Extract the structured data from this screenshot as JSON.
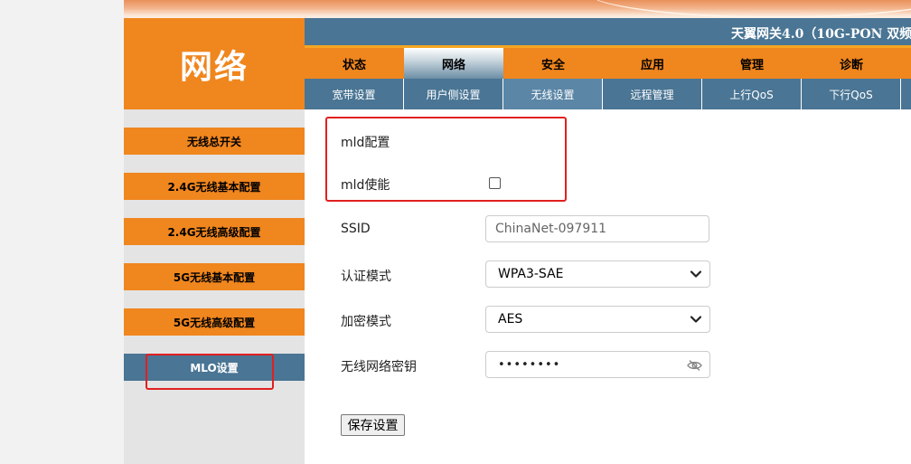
{
  "header": {
    "logo_text": "网络",
    "title": "天翼网关4.0（10G-PON 双频"
  },
  "main_tabs": [
    {
      "label": "状态"
    },
    {
      "label": "网络"
    },
    {
      "label": "安全"
    },
    {
      "label": "应用"
    },
    {
      "label": "管理"
    },
    {
      "label": "诊断"
    }
  ],
  "sub_tabs": [
    {
      "label": "宽带设置"
    },
    {
      "label": "用户侧设置"
    },
    {
      "label": "无线设置"
    },
    {
      "label": "远程管理"
    },
    {
      "label": "上行QoS"
    },
    {
      "label": "下行QoS"
    }
  ],
  "sidebar": {
    "items": [
      {
        "label": "无线总开关"
      },
      {
        "label": "2.4G无线基本配置"
      },
      {
        "label": "2.4G无线高级配置"
      },
      {
        "label": "5G无线基本配置"
      },
      {
        "label": "5G无线高级配置"
      },
      {
        "label": "MLO设置"
      }
    ]
  },
  "form": {
    "mld_config_label": "mld配置",
    "mld_enable_label": "mld使能",
    "mld_enable_checked": false,
    "ssid_label": "SSID",
    "ssid_value": "ChinaNet-097911",
    "auth_label": "认证模式",
    "auth_value": "WPA3-SAE",
    "encrypt_label": "加密模式",
    "encrypt_value": "AES",
    "password_label": "无线网络密钥",
    "password_value": "••••••••",
    "save_label": "保存设置"
  },
  "colors": {
    "accent_orange": "#f0861e",
    "nav_blue": "#4a7594",
    "highlight_red": "#e02020"
  }
}
